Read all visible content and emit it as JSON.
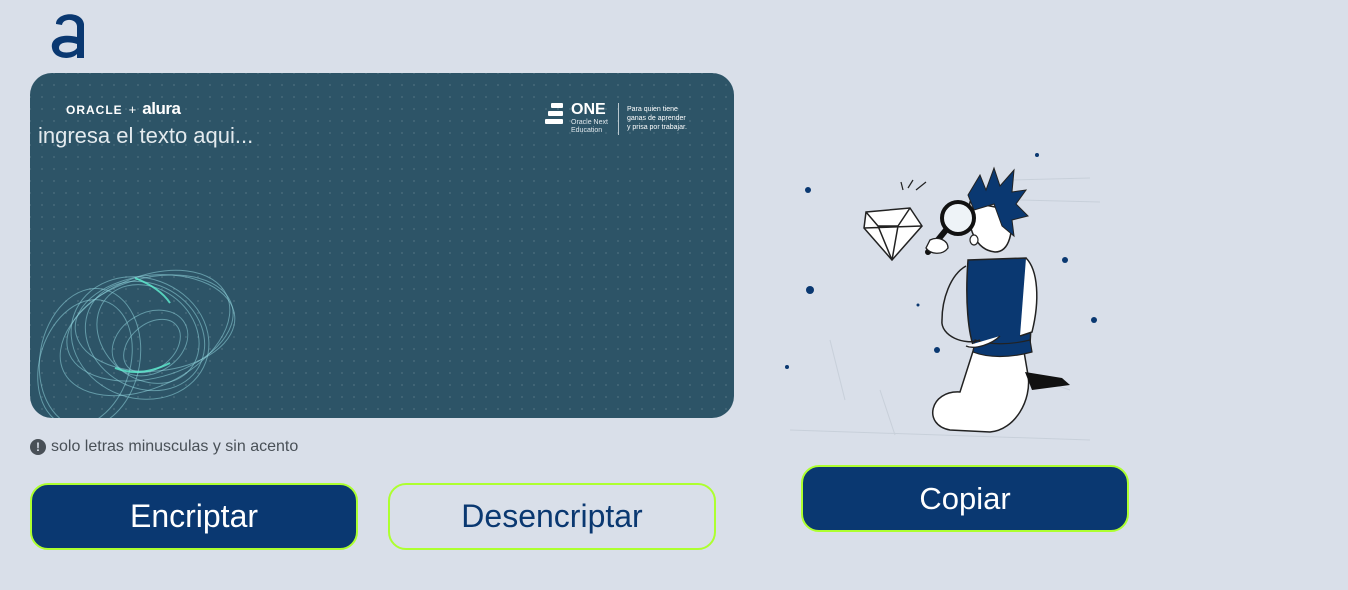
{
  "logo": {
    "icon": "alura-logo-icon",
    "color": "#0a3871"
  },
  "input_card": {
    "brand_left": {
      "oracle": "ORACLE",
      "plus": "+",
      "alura": "alura"
    },
    "placeholder": "ingresa el texto aqui...",
    "brand_right": {
      "one_title": "ONE",
      "one_sub_line1": "Oracle Next",
      "one_sub_line2": "Education",
      "tag_line1": "Para quien tiene",
      "tag_line2": "ganas de aprender",
      "tag_line3": "y prisa por trabajar."
    },
    "background_color": "#2d5467"
  },
  "hint": {
    "icon": "exclamation-circle-icon",
    "text": "solo letras minusculas y sin acento"
  },
  "buttons": {
    "encrypt_label": "Encriptar",
    "decrypt_label": "Desencriptar",
    "copy_label": "Copiar"
  },
  "colors": {
    "primary": "#0a3871",
    "accent_border": "#adff2f",
    "page_background": "#d9dfe9"
  }
}
